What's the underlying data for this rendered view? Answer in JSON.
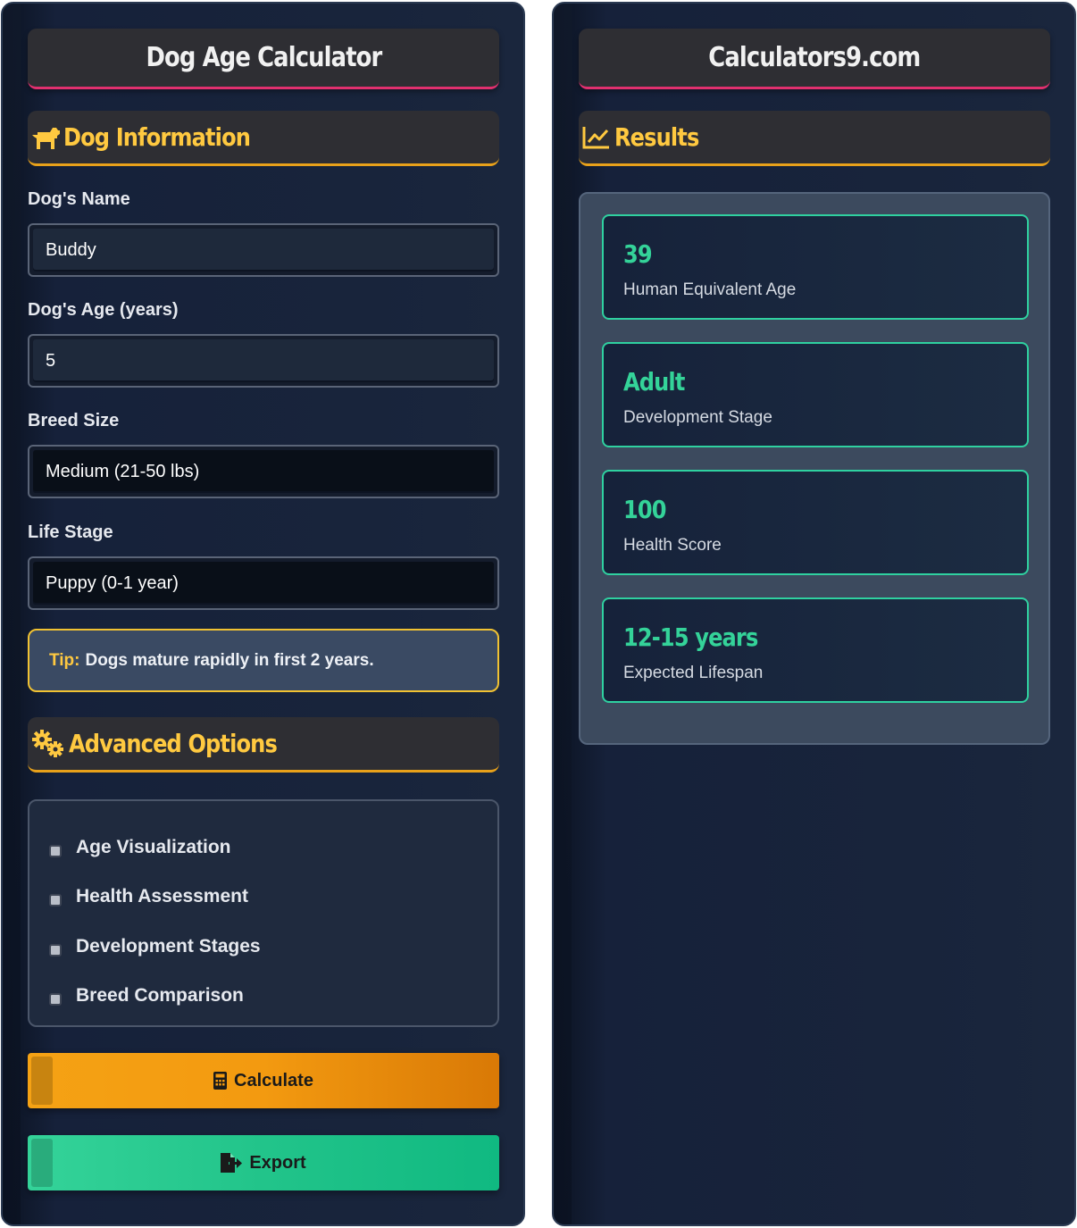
{
  "calculator": {
    "title": "Dog Age Calculator",
    "dog_info": {
      "heading": "Dog Information",
      "icon": "dog-icon",
      "name_label": "Dog's Name",
      "name_value": "Buddy",
      "age_label": "Dog's Age (years)",
      "age_value": "5",
      "breed_label": "Breed Size",
      "breed_value": "Medium (21-50 lbs)",
      "stage_label": "Life Stage",
      "stage_value": "Puppy (0-1 year)"
    },
    "tip": {
      "key": "Tip:",
      "text": "Dogs mature rapidly in first 2 years."
    },
    "advanced": {
      "heading": "Advanced Options",
      "icon": "gears-icon",
      "options": [
        {
          "label": "Age Visualization",
          "checked": false
        },
        {
          "label": "Health Assessment",
          "checked": false
        },
        {
          "label": "Development Stages",
          "checked": false
        },
        {
          "label": "Breed Comparison",
          "checked": false
        }
      ]
    },
    "buttons": {
      "calculate_label": "Calculate",
      "calculate_icon": "calculator-icon",
      "calculate_color": "#f39a10",
      "export_label": "Export",
      "export_icon": "file-export-icon",
      "export_color": "#22c48a"
    }
  },
  "site": {
    "title": "Calculators9.com",
    "results_heading": "Results",
    "results_icon": "chart-line-icon",
    "results": [
      {
        "value": "39",
        "label": "Human Equivalent Age"
      },
      {
        "value": "Adult",
        "label": "Development Stage"
      },
      {
        "value": "100",
        "label": "Health Score"
      },
      {
        "value": "12-15 years",
        "label": "Expected Lifespan"
      }
    ],
    "accent_color": "#34d399"
  },
  "colors": {
    "heading_gold": "#ffc940",
    "title_underline": "#e0306e",
    "section_underline": "#e8a11a"
  }
}
